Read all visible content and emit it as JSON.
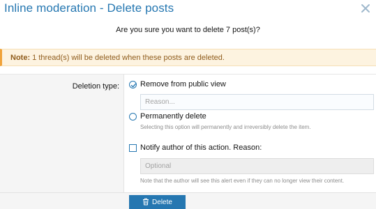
{
  "dialog": {
    "title": "Inline moderation - Delete posts",
    "close_icon": "close-icon"
  },
  "confirm_text": "Are you sure you want to delete 7 post(s)?",
  "notice": {
    "label": "Note:",
    "text": " 1 thread(s) will be deleted when these posts are deleted."
  },
  "form": {
    "deletion_type_label": "Deletion type:",
    "option_remove": {
      "label": "Remove from public view",
      "checked": true
    },
    "reason_placeholder": "Reason...",
    "option_permanent": {
      "label": "Permanently delete",
      "checked": false,
      "hint": "Selecting this option will permanently and irreversibly delete the item."
    },
    "notify": {
      "label": "Notify author of this action. Reason:",
      "checked": false,
      "placeholder": "Optional",
      "hint": "Note that the author will see this alert even if they can no longer view their content."
    }
  },
  "footer": {
    "delete_label": "Delete",
    "delete_icon": "trash-icon"
  },
  "colors": {
    "accent": "#2577b1",
    "notice_bg": "#fdf3e0",
    "notice_border": "#f0a33a"
  }
}
